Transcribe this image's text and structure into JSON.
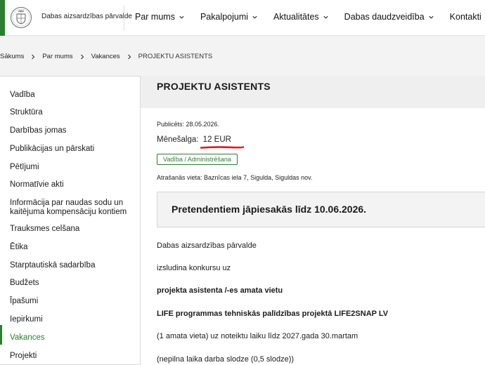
{
  "header": {
    "org_name": "Dabas aizsardzības pārvalde",
    "nav": [
      {
        "label": "Par mums"
      },
      {
        "label": "Pakalpojumi"
      },
      {
        "label": "Aktualitātes"
      },
      {
        "label": "Dabas daudzveidība"
      },
      {
        "label": "Kontakti"
      }
    ]
  },
  "breadcrumb": {
    "items": [
      "Sākums",
      "Par mums",
      "Vakances"
    ],
    "current": "PROJEKTU ASISTENTS"
  },
  "sidebar": {
    "items": [
      {
        "label": "Vadība"
      },
      {
        "label": "Struktūra"
      },
      {
        "label": "Darbības jomas"
      },
      {
        "label": "Publikācijas un pārskati"
      },
      {
        "label": "Pētījumi"
      },
      {
        "label": "Normatīvie akti"
      },
      {
        "label": "Informācija par naudas sodu un kaitējuma kompensāciju kontiem"
      },
      {
        "label": "Trauksmes celšana"
      },
      {
        "label": "Ētika"
      },
      {
        "label": "Starptautiskā sadarbība"
      },
      {
        "label": "Budžets"
      },
      {
        "label": "Īpašumi"
      },
      {
        "label": "Iepirkumi"
      },
      {
        "label": "Vakances"
      },
      {
        "label": "Projekti"
      }
    ],
    "active": "Vakances"
  },
  "main": {
    "title": "PROJEKTU ASISTENTS",
    "published": "Publicēts: 28.05.2026.",
    "salary_label": "Mēnešalga:",
    "salary_value": "12 EUR",
    "tag": "Vadība / Administrēšana",
    "location": "Atrašanās vieta:  Baznīcas iela 7, Sigulda, Siguldas nov.",
    "deadline": "Pretendentiem jāpiesakās līdz 10.06.2026.",
    "paragraphs": [
      "Dabas aizsardzības pārvalde",
      "izsludina konkursu uz",
      "projekta asistenta /-es amata vietu",
      "LIFE programmas tehniskās palīdzības projektā LIFE2SNAP LV",
      "(1 amata vieta) uz noteiktu laiku līdz 2027.gada 30.martam",
      "(nepilna laika darba slodze (0,5 slodze))"
    ]
  },
  "colors": {
    "accent": "#2e7d32",
    "underline": "#e0191f"
  }
}
